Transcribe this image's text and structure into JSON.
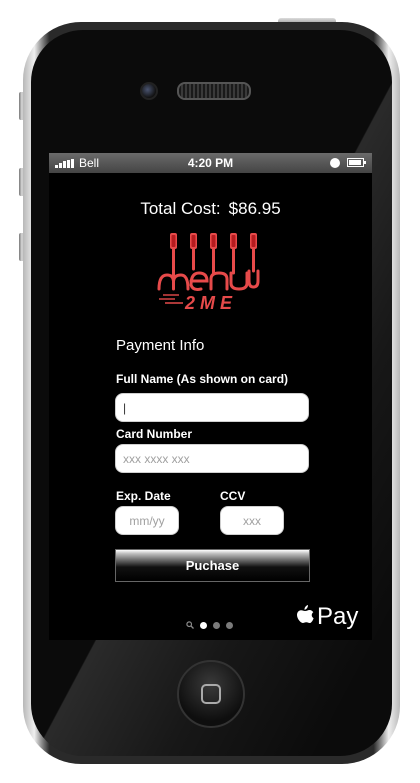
{
  "status_bar": {
    "carrier": "Bell",
    "time": "4:20 PM",
    "signal_icon": "signal-bars-icon",
    "alarm_icon": "alarm-icon",
    "battery_icon": "battery-icon"
  },
  "order": {
    "total_label": "Total Cost:",
    "total_value": "$86.95"
  },
  "logo": {
    "word": "MENU",
    "sub": "2ME",
    "color": "#e64a4a",
    "accent": "#c61f24"
  },
  "payment": {
    "title": "Payment Info",
    "full_name": {
      "label": "Full Name (As shown on card)",
      "value": "|",
      "placeholder": ""
    },
    "card_number": {
      "label": "Card Number",
      "value": "",
      "placeholder": "xxx xxxx xxx"
    },
    "exp_date": {
      "label": "Exp. Date",
      "value": "",
      "placeholder": "mm/yy"
    },
    "ccv": {
      "label": "CCV",
      "value": "",
      "placeholder": "xxx"
    },
    "purchase_label": "Puchase"
  },
  "apple_pay": {
    "label": "Pay",
    "icon": "apple-icon"
  },
  "page_indicator": {
    "pages": 3,
    "active_index": 0,
    "search_icon": "search-icon"
  }
}
